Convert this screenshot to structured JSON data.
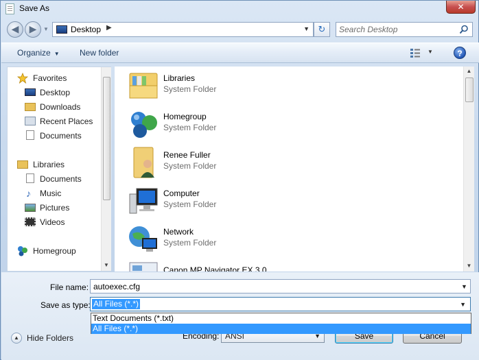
{
  "window": {
    "title": "Save As",
    "close_label": "✕"
  },
  "nav": {
    "address": "Desktop",
    "search_placeholder": "Search Desktop"
  },
  "toolbar": {
    "organize": "Organize",
    "new_folder": "New folder",
    "help": "?"
  },
  "sidebar": {
    "favorites": {
      "label": "Favorites",
      "items": [
        "Desktop",
        "Downloads",
        "Recent Places",
        "Documents"
      ]
    },
    "libraries": {
      "label": "Libraries",
      "items": [
        "Documents",
        "Music",
        "Pictures",
        "Videos"
      ]
    },
    "homegroup": "Homegroup"
  },
  "files": [
    {
      "name": "Libraries",
      "type": "System Folder",
      "icon": "libraries-icon"
    },
    {
      "name": "Homegroup",
      "type": "System Folder",
      "icon": "homegroup-icon"
    },
    {
      "name": "Renee Fuller",
      "type": "System Folder",
      "icon": "user-folder-icon"
    },
    {
      "name": "Computer",
      "type": "System Folder",
      "icon": "computer-icon"
    },
    {
      "name": "Network",
      "type": "System Folder",
      "icon": "network-icon"
    },
    {
      "name": "Canon MP Navigator EX 3.0",
      "type": "",
      "icon": "shortcut-icon"
    }
  ],
  "form": {
    "file_name_label": "File name:",
    "file_name_value": "autoexec.cfg",
    "save_type_label": "Save as type:",
    "save_type_value": "All Files  (*.*)",
    "save_type_options": [
      "Text Documents (*.txt)",
      "All Files  (*.*)"
    ],
    "encoding_label": "Encoding:",
    "encoding_value": "ANSI",
    "hide_folders": "Hide Folders",
    "save_button": "Save",
    "cancel_button": "Cancel"
  }
}
